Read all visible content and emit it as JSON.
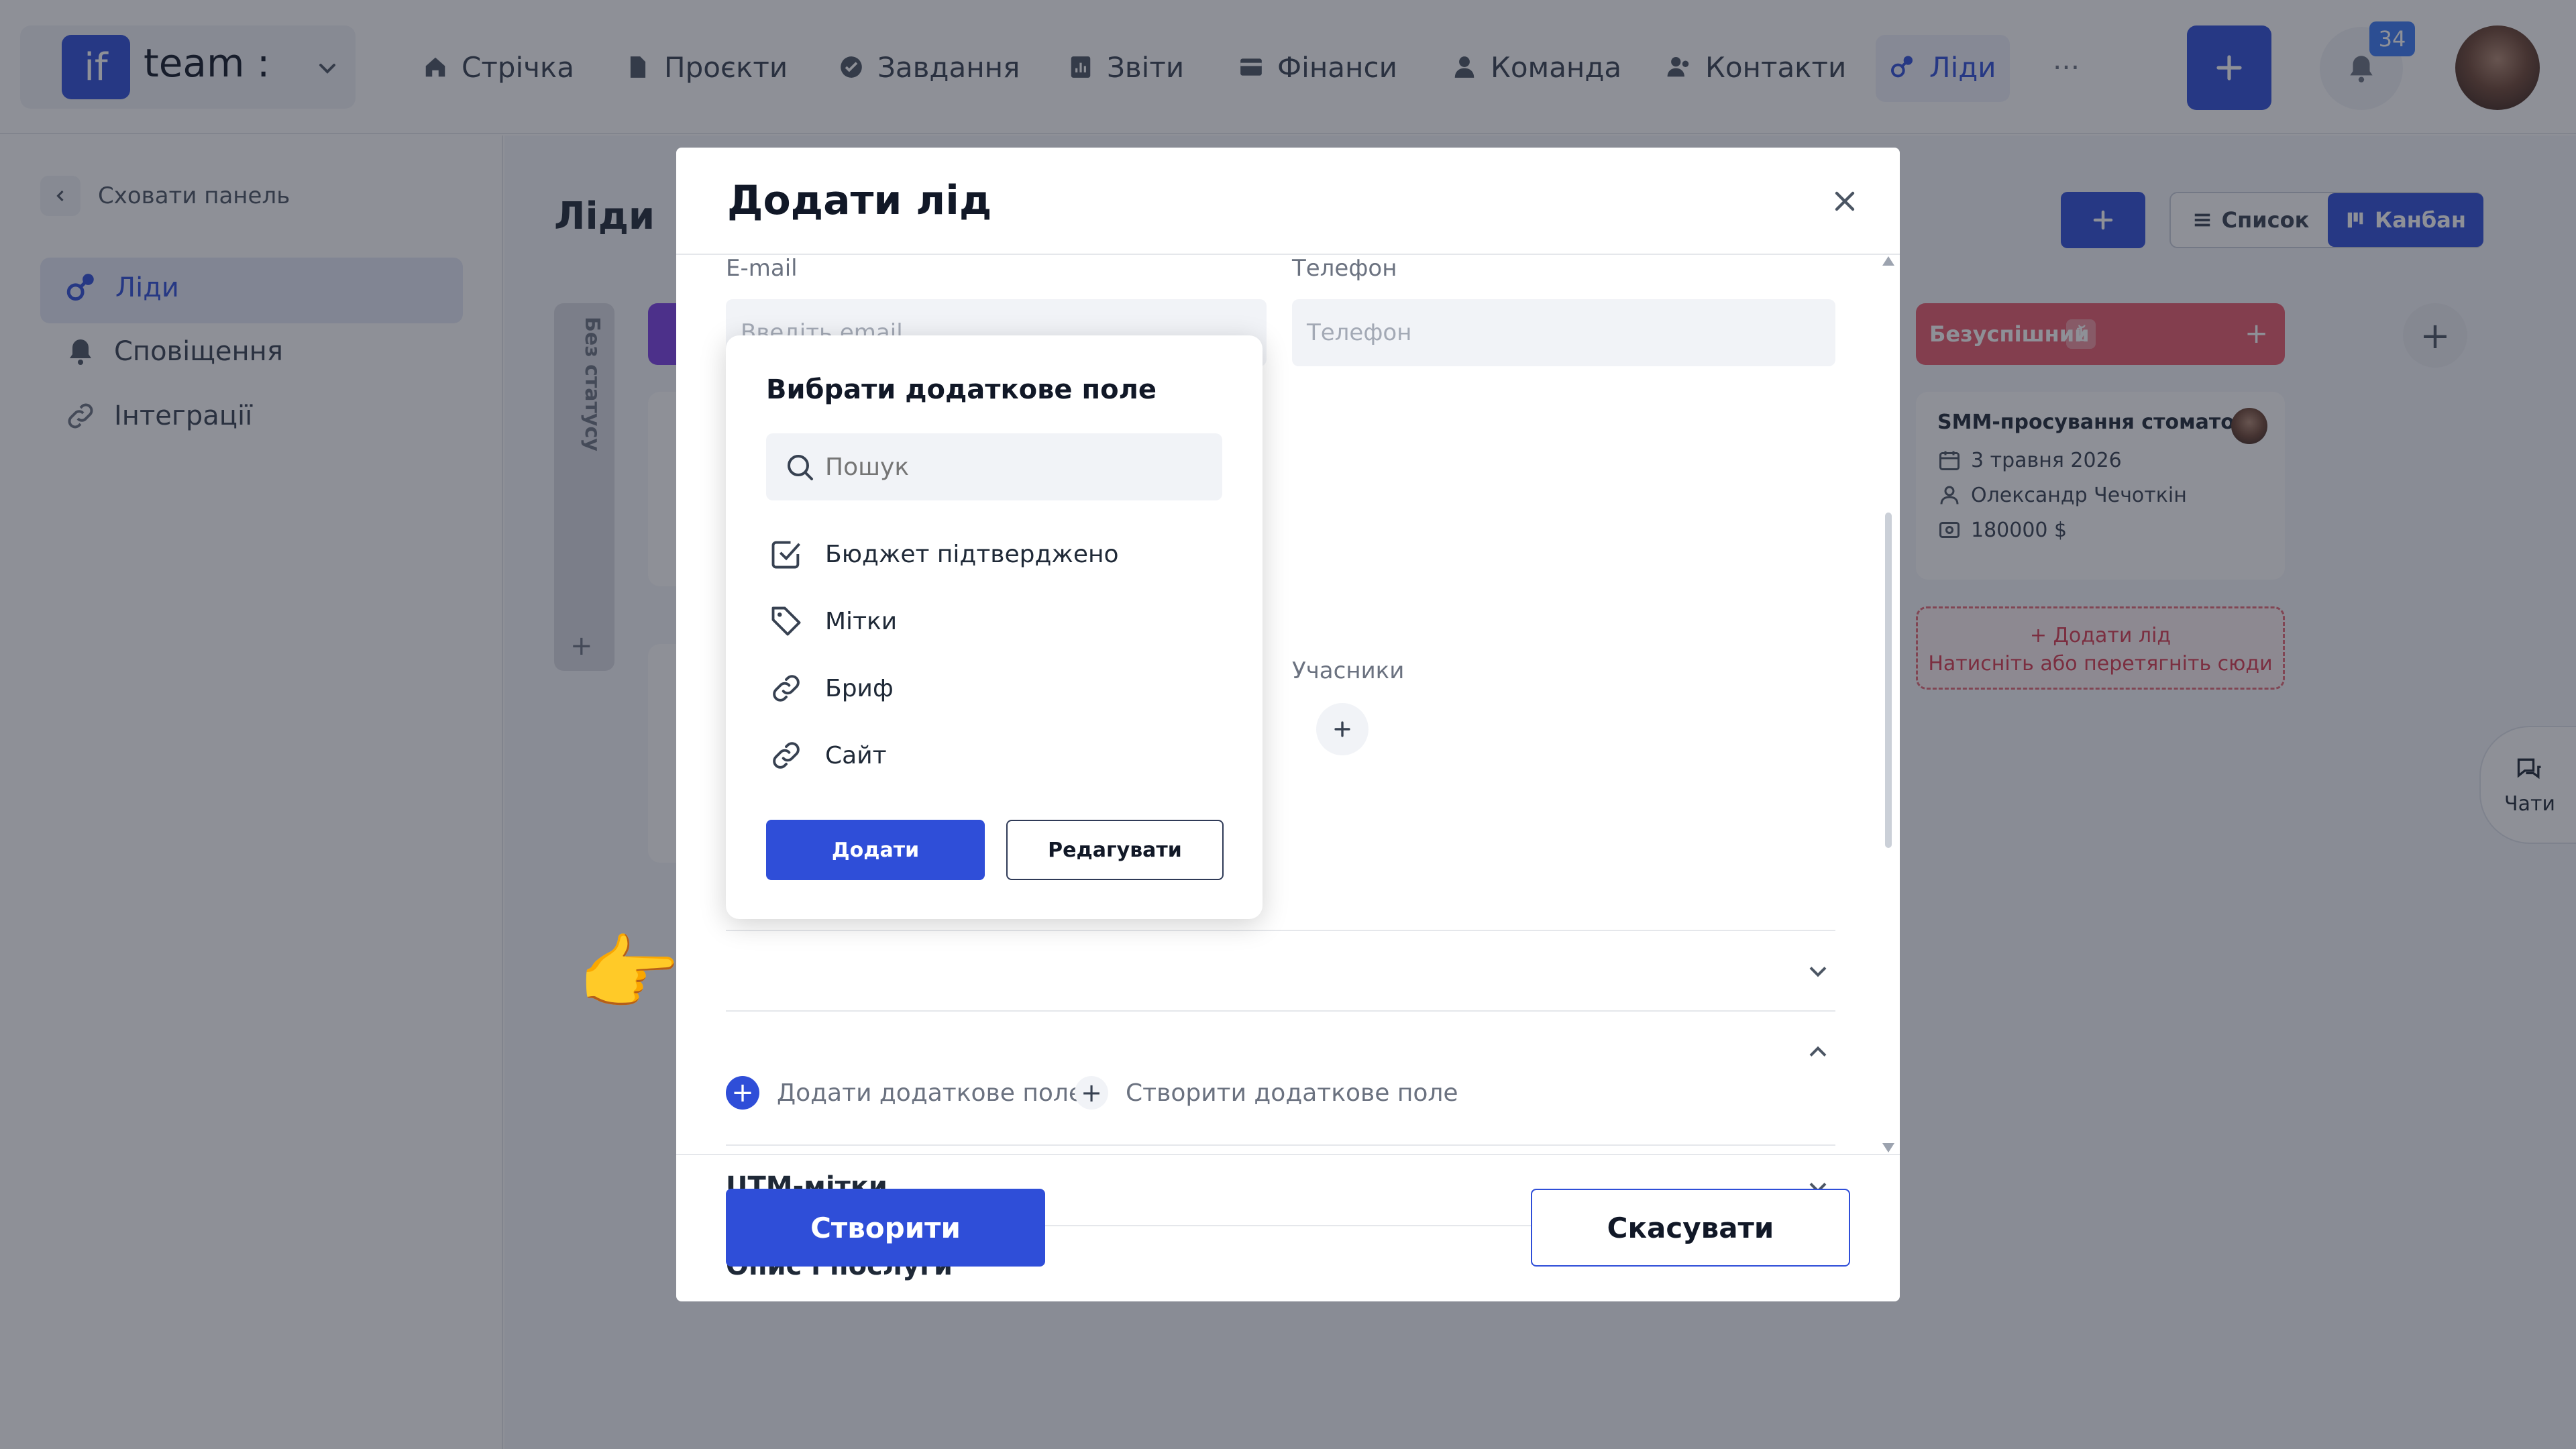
{
  "brand": {
    "logo_text": "if",
    "team_name": "team :"
  },
  "nav": {
    "items": [
      {
        "label": "Стрічка",
        "icon": "home-icon"
      },
      {
        "label": "Проєкти",
        "icon": "file-icon"
      },
      {
        "label": "Завдання",
        "icon": "check-circle-icon"
      },
      {
        "label": "Звіти",
        "icon": "report-icon"
      },
      {
        "label": "Фінанси",
        "icon": "wallet-icon"
      },
      {
        "label": "Команда",
        "icon": "user-icon"
      },
      {
        "label": "Контакти",
        "icon": "contacts-icon"
      },
      {
        "label": "Ліди",
        "icon": "leads-icon"
      }
    ],
    "more": "···",
    "notifications_count": "34",
    "accent": "#2f4ed8"
  },
  "sidebar": {
    "hide_label": "Сховати панель",
    "items": [
      {
        "label": "Ліди"
      },
      {
        "label": "Сповіщення"
      },
      {
        "label": "Інтеграції"
      }
    ]
  },
  "page": {
    "title": "Ліди",
    "add_button": "+",
    "view_list": "Список",
    "view_kanban": "Канбан",
    "no_status_label": "Без статусу",
    "column_plus": "+",
    "fail_column": {
      "title": "Безуспішний",
      "count": "1",
      "color": "#e85a6c"
    },
    "lead_card": {
      "title": "SMM-просування стомато...",
      "date": "3 травня 2026",
      "person": "Олександр Чечоткін",
      "amount": "180000 $"
    },
    "add_lead_line1": "+ Додати лід",
    "add_lead_line2": "Натисніть або перетягніть сюди",
    "chats_label": "Чати"
  },
  "modal": {
    "title": "Додати лід",
    "email_label": "E-mail",
    "email_placeholder": "Введіть email",
    "phone_label": "Телефон",
    "phone_placeholder": "Телефон",
    "members_label": "Учасники",
    "add_extra_field": "Додати додаткове поле",
    "create_extra_field": "Створити додаткове поле",
    "utm_title": "UTM-мітки",
    "description_title": "Опис і послуги",
    "create_button": "Створити",
    "cancel_button": "Скасувати"
  },
  "popover": {
    "title": "Вибрати додаткове поле",
    "search_placeholder": "Пошук",
    "items": [
      {
        "label": "Бюджет підтверджено",
        "icon": "checkbox-icon"
      },
      {
        "label": "Мітки",
        "icon": "tag-icon"
      },
      {
        "label": "Бриф",
        "icon": "link-icon"
      },
      {
        "label": "Сайт",
        "icon": "link-icon"
      }
    ],
    "add_button": "Додати",
    "edit_button": "Редагувати"
  }
}
